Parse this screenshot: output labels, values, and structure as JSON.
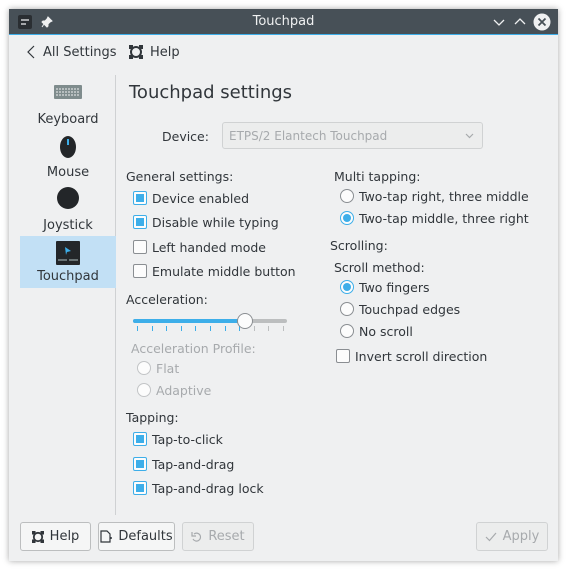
{
  "window": {
    "title": "Touchpad"
  },
  "toolbar": {
    "back_label": "All Settings",
    "help_label": "Help"
  },
  "sidebar": {
    "items": [
      {
        "label": "Keyboard",
        "icon": "keyboard-icon",
        "selected": false
      },
      {
        "label": "Mouse",
        "icon": "mouse-icon",
        "selected": false
      },
      {
        "label": "Joystick",
        "icon": "joystick-icon",
        "selected": false
      },
      {
        "label": "Touchpad",
        "icon": "touchpad-icon",
        "selected": true
      }
    ]
  },
  "main": {
    "title": "Touchpad settings",
    "device": {
      "label": "Device:",
      "value": "ETPS/2 Elantech Touchpad",
      "enabled": false
    },
    "general": {
      "label": "General settings:",
      "items": [
        {
          "label": "Device enabled",
          "checked": true
        },
        {
          "label": "Disable while typing",
          "checked": true
        },
        {
          "label": "Left handed mode",
          "checked": false
        },
        {
          "label": "Emulate middle button",
          "checked": false
        }
      ]
    },
    "acceleration": {
      "label": "Acceleration:",
      "value_percent": 75
    },
    "profile": {
      "label": "Acceleration Profile:",
      "enabled": false,
      "options": [
        {
          "label": "Flat",
          "selected": false
        },
        {
          "label": "Adaptive",
          "selected": false
        }
      ]
    },
    "tapping": {
      "label": "Tapping:",
      "items": [
        {
          "label": "Tap-to-click",
          "checked": true
        },
        {
          "label": "Tap-and-drag",
          "checked": true
        },
        {
          "label": "Tap-and-drag lock",
          "checked": true
        }
      ]
    },
    "multi": {
      "label": "Multi tapping:",
      "options": [
        {
          "label": "Two-tap right, three middle",
          "selected": false
        },
        {
          "label": "Two-tap middle, three right",
          "selected": true
        }
      ]
    },
    "scrolling": {
      "label": "Scrolling:",
      "method_label": "Scroll method:",
      "options": [
        {
          "label": "Two fingers",
          "selected": true
        },
        {
          "label": "Touchpad edges",
          "selected": false
        },
        {
          "label": "No scroll",
          "selected": false
        }
      ],
      "invert": {
        "label": "Invert scroll direction",
        "checked": false
      }
    }
  },
  "footer": {
    "help": "Help",
    "defaults": "Defaults",
    "reset": "Reset",
    "apply": "Apply"
  },
  "colors": {
    "accent": "#3daee9",
    "titlebar": "#475057",
    "selection": "#c2e0f5"
  }
}
